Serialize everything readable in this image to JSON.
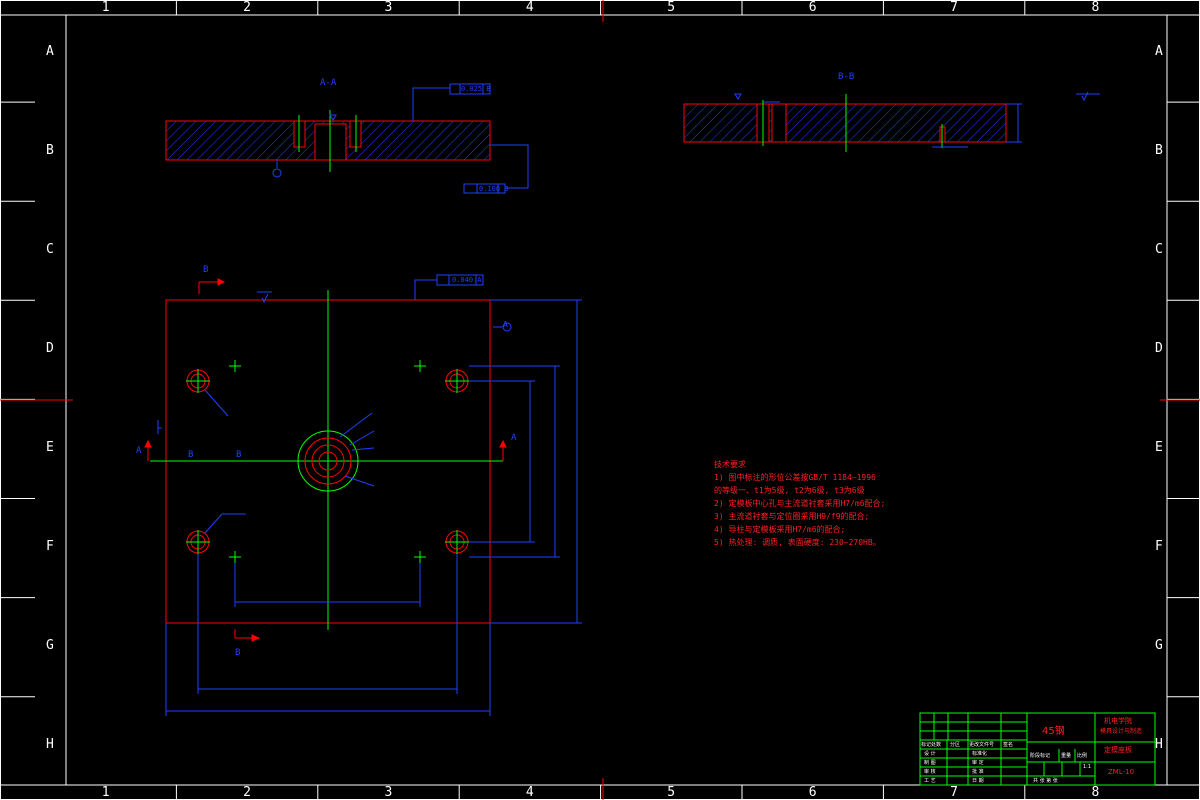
{
  "frame": {
    "columns": [
      "1",
      "2",
      "3",
      "4",
      "5",
      "6",
      "7",
      "8"
    ],
    "rows": [
      "A",
      "B",
      "C",
      "D",
      "E",
      "F",
      "G",
      "H"
    ]
  },
  "views": {
    "section_aa": "A-A",
    "section_bb": "B-B",
    "tol_flatness": "0.025 B",
    "tol_perp": "0.100 B",
    "tol_plan": "0.040 A",
    "datum_b": "B",
    "datum_a": "A",
    "cut_b": "B",
    "cut_a": "A"
  },
  "notes": {
    "title": "技术要求",
    "lines": [
      "1) 图中标注的形位公差按GB/T 1184—1996",
      "的等级一、t1为5级, t2为6级, t3为6级",
      "2) 定模板中心孔与主流道衬套采用H7/m6配合;",
      "3) 主流道衬套与定位圈采用H9/f9的配合;",
      "4) 导柱与定模板采用H7/m6的配合;",
      "5) 热处理: 调质, 表面硬度: 230~270HB。"
    ]
  },
  "title_block": {
    "material": "45钢",
    "school": "机电学院",
    "school_sub": "模具设计与制造",
    "part_name": "定模座板",
    "drawing_no": "ZML-10",
    "row_labels": [
      "标记处数",
      "设 计",
      "制 图",
      "审 核",
      "工 艺"
    ],
    "col_labels": [
      "分区",
      "更改文件号",
      "签名",
      "年月日"
    ],
    "mid_labels": [
      "标准化",
      "审 定",
      "批 准",
      "日 期"
    ],
    "right_labels": [
      "阶段标记",
      "重量",
      "比例"
    ],
    "scale": "1:1",
    "sheet": "共 张 第 张"
  },
  "colors": {
    "background": "#000000",
    "frame": "#ffffff",
    "outline": "#ff0000",
    "dimension": "#2040ff",
    "center": "#00ff00",
    "notes": "#ff2020"
  }
}
